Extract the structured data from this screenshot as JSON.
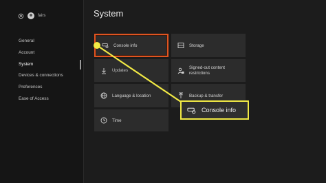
{
  "sidebar": {
    "gamertag": "fairs",
    "items": [
      {
        "label": "General"
      },
      {
        "label": "Account"
      },
      {
        "label": "System"
      },
      {
        "label": "Devices & connections"
      },
      {
        "label": "Preferences"
      },
      {
        "label": "Ease of Access"
      }
    ],
    "active_index": 2
  },
  "page_title": "System",
  "tiles": {
    "console_info": {
      "label": "Console info",
      "icon": "console-icon"
    },
    "storage": {
      "label": "Storage",
      "icon": "storage-icon"
    },
    "updates": {
      "label": "Updates",
      "icon": "download-icon"
    },
    "signed_out_line1": "Signed-out content",
    "signed_out_line2": "restrictions",
    "language": {
      "label": "Language & location",
      "icon": "globe-icon"
    },
    "backup": {
      "label": "Backup & transfer",
      "icon": "upload-icon"
    },
    "time": {
      "label": "Time",
      "icon": "clock-icon"
    }
  },
  "callout": {
    "label": "Console info",
    "color": "#f2ea45"
  },
  "colors": {
    "accent_selected": "#e05420",
    "callout": "#f2ea45",
    "background": "#1c1c1c",
    "tile": "#2c2c2c"
  }
}
